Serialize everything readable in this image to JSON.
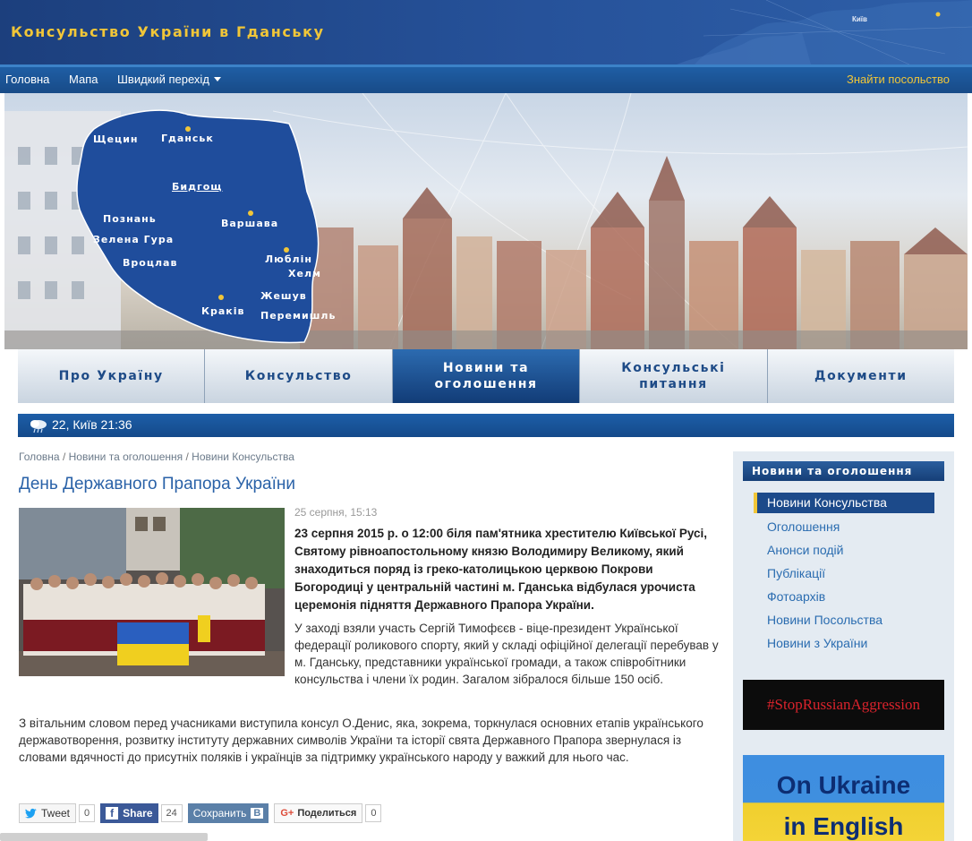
{
  "header": {
    "site_title": "Консульство України в Гданську",
    "map_label": "Київ"
  },
  "topnav": {
    "home": "Головна",
    "map": "Мапа",
    "quick": "Швидкий перехід",
    "find": "Знайти посольство"
  },
  "hero": {
    "cities": [
      "Щецин",
      "Гданськ",
      "Бидгощ",
      "Познань",
      "Варшава",
      "Зелена Гура",
      "Вроцлав",
      "Люблін",
      "Хелм",
      "Жешув",
      "Краків",
      "Перемишль"
    ]
  },
  "mainnav": {
    "tabs": [
      {
        "l1": "Про Україну",
        "l2": ""
      },
      {
        "l1": "Консульство",
        "l2": ""
      },
      {
        "l1": "Новини та",
        "l2": "оголошення"
      },
      {
        "l1": "Консульські",
        "l2": "питання"
      },
      {
        "l1": "Документи",
        "l2": ""
      }
    ]
  },
  "weather": {
    "text": "22, Київ 21:36"
  },
  "breadcrumb": {
    "home": "Головна",
    "sep": "/",
    "section": "Новини та оголошення",
    "current": "Новини Консульства"
  },
  "article": {
    "title": "День Державного Прапора України",
    "date": "25 серпня, 15:13",
    "lead": "23 серпня 2015 р. о 12:00 біля пам'ятника хрестителю Київської Русі, Святому рівноапостольному князю Володимиру Великому, який знаходиться поряд із греко-католицькою церквою Покрови Богородиці у центральній частині м. Гданська відбулася урочиста церемонія підняття Державного Прапора України.",
    "para1": "У заході взяли участь  Сергій Тимофєєв - віце-президент Української федерації роликового спорту, який у складі офіційної делегації перебував у м. Гданську, представники української громади, а також співробітники консульства і члени їх родин. Загалом зібралося більше 150 осіб.",
    "para2": "З вітальним словом перед учасниками виступила   консул О.Денис, яка, зокрема, торкнулася основних етапів українського державотворення, розвитку інституту державних символів України та історії свята Державного Прапора звернулася із словами вдячності до присутніх поляків і українців за підтримку українського народу у важкий для нього час."
  },
  "share": {
    "tweet": "Tweet",
    "tweet_count": "0",
    "fb": "Share",
    "fb_count": "24",
    "vk": "Сохранить",
    "vk_logo": "B",
    "gp": "Поделиться",
    "gp_count": "0"
  },
  "sidebar": {
    "heading": "Новини та оголошення",
    "items": [
      {
        "label": "Новини Консульства"
      },
      {
        "label": "Оголошення"
      },
      {
        "label": "Анонси подій"
      },
      {
        "label": "Публікації"
      },
      {
        "label": "Фотоархів"
      },
      {
        "label": "Новини Посольства"
      },
      {
        "label": "Новини з України"
      }
    ],
    "banner1": "#StopRussianAggression",
    "banner2_l1": "On Ukraine",
    "banner2_l2": "in English"
  },
  "colors": {
    "header_bg": "#26529a",
    "accent_gold": "#f1c638",
    "nav_blue": "#1c4a8a",
    "link": "#2a6cb0"
  }
}
